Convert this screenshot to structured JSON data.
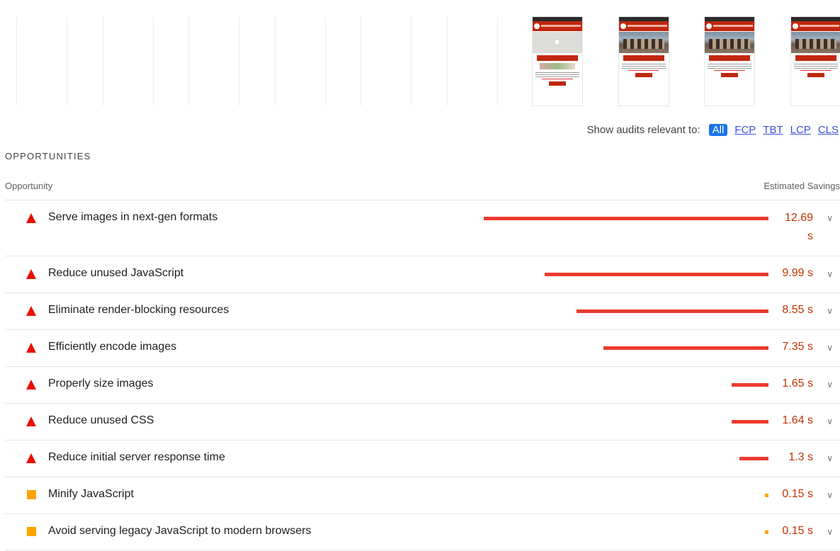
{
  "filmstrip": {
    "blank_frames": 6,
    "screenshot_frames": 4
  },
  "filter": {
    "label": "Show audits relevant to:",
    "chips": [
      "All",
      "FCP",
      "TBT",
      "LCP",
      "CLS"
    ],
    "active": "All"
  },
  "section": {
    "title": "OPPORTUNITIES",
    "col_opportunity": "Opportunity",
    "col_savings": "Estimated Savings"
  },
  "audits": [
    {
      "title": "Serve images in next-gen formats",
      "savings": "12.69 s",
      "savings_seconds": 12.69,
      "rating": "fail"
    },
    {
      "title": "Reduce unused JavaScript",
      "savings": "9.99 s",
      "savings_seconds": 9.99,
      "rating": "fail"
    },
    {
      "title": "Eliminate render-blocking resources",
      "savings": "8.55 s",
      "savings_seconds": 8.55,
      "rating": "fail"
    },
    {
      "title": "Efficiently encode images",
      "savings": "7.35 s",
      "savings_seconds": 7.35,
      "rating": "fail"
    },
    {
      "title": "Properly size images",
      "savings": "1.65 s",
      "savings_seconds": 1.65,
      "rating": "fail"
    },
    {
      "title": "Reduce unused CSS",
      "savings": "1.64 s",
      "savings_seconds": 1.64,
      "rating": "fail"
    },
    {
      "title": "Reduce initial server response time",
      "savings": "1.3 s",
      "savings_seconds": 1.3,
      "rating": "fail"
    },
    {
      "title": "Minify JavaScript",
      "savings": "0.15 s",
      "savings_seconds": 0.15,
      "rating": "average"
    },
    {
      "title": "Avoid serving legacy JavaScript to modern browsers",
      "savings": "0.15 s",
      "savings_seconds": 0.15,
      "rating": "average"
    }
  ],
  "colors": {
    "fail": "#eb0f00",
    "average": "#ffa400",
    "accent": "#1a73e8"
  }
}
